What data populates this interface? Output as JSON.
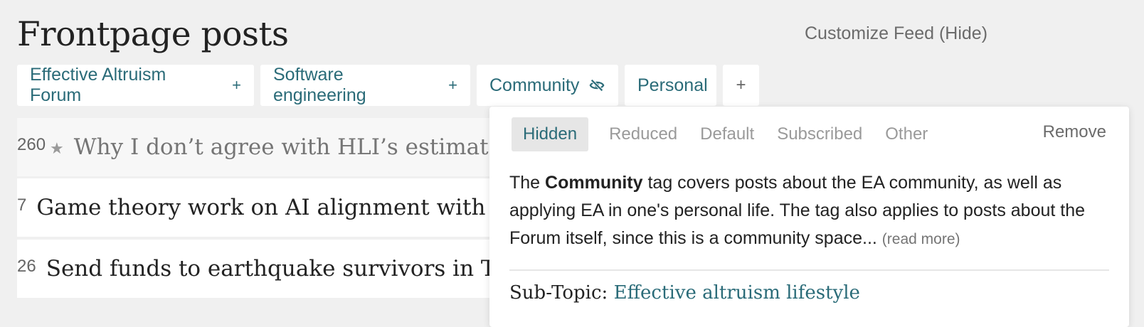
{
  "header": {
    "title": "Frontpage posts",
    "customize_label": "Customize Feed (Hide)"
  },
  "tags": [
    {
      "label": "Effective Altruism Forum",
      "icon": "plus-icon",
      "icon_glyph": "+"
    },
    {
      "label": "Software engineering",
      "icon": "plus-icon",
      "icon_glyph": "+"
    },
    {
      "label": "Community",
      "icon": "eye-slash-icon"
    },
    {
      "label": "Personal"
    }
  ],
  "add_tag_glyph": "+",
  "posts": [
    {
      "karma": "260",
      "title": "Why I don’t agree with HLI’s estimate of household spillovers from therapy",
      "pinned": true
    },
    {
      "karma": "7",
      "title": "Game theory work on AI alignment with diverse AI systems, human individuals, & human groups"
    },
    {
      "karma": "26",
      "title": "Send funds to earthquake survivors in Turkey via GiveDirectly"
    }
  ],
  "popover": {
    "filters": [
      "Hidden",
      "Reduced",
      "Default",
      "Subscribed",
      "Other"
    ],
    "selected_filter": "Hidden",
    "remove_label": "Remove",
    "desc_prefix": "The ",
    "desc_tag": "Community",
    "desc_suffix": " tag covers posts about the EA community, as well as applying EA in one's personal life. The tag also applies to posts about the Forum itself, since this is a community space...",
    "read_more": "(read more)",
    "subtopic_label": "Sub-Topic: ",
    "subtopic_link": "Effective altruism lifestyle"
  },
  "colors": {
    "accent": "#2a6b78",
    "background": "#f0f0f0",
    "muted": "#9a9a9a"
  }
}
